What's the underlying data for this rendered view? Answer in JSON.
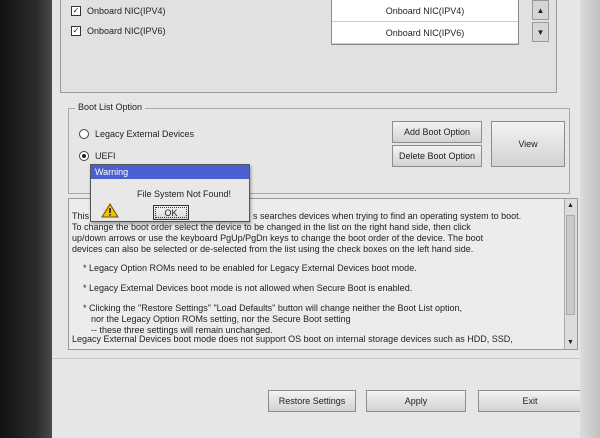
{
  "boot_sequence": {
    "items": [
      {
        "label": "Onboard NIC(IPV4)",
        "checked": true
      },
      {
        "label": "Onboard NIC(IPV6)",
        "checked": true
      }
    ],
    "order_list": [
      "Onboard NIC(IPV4)",
      "Onboard NIC(IPV6)"
    ],
    "up_arrow": "▲",
    "down_arrow": "▼",
    "check_mark": "✓"
  },
  "boot_list_option": {
    "legend": "Boot List Option",
    "options": [
      {
        "label": "Legacy External Devices",
        "selected": false
      },
      {
        "label": "UEFI",
        "selected": true
      }
    ],
    "add_boot_option": "Add Boot Option",
    "delete_boot_option": "Delete Boot Option",
    "view": "View"
  },
  "warning_dialog": {
    "title": "Warning",
    "message": "File System Not Found!",
    "ok": "OK"
  },
  "help_text": {
    "line1_prefix": "This",
    "line1_rest": "s searches devices when trying to find an operating system to boot.",
    "line2": "To change the boot order select the device to be changed in the list on the right hand side, then click",
    "line3": "up/down arrows or use the keyboard PgUp/PgDn keys to change the boot order of the device. The boot",
    "line4": "devices can also be selected or de-selected from the list using the check boxes on the left hand side.",
    "bullet1": "* Legacy Option ROMs need to be enabled for Legacy External Devices boot mode.",
    "bullet2": "* Legacy External Devices boot mode is not allowed when Secure Boot is enabled.",
    "bullet3a": "* Clicking the \"Restore Settings\" \"Load Defaults\" button will change neither the Boot List option,",
    "bullet3b": "nor the Legacy Option ROMs setting, nor the Secure Boot setting",
    "bullet3c": "-- these three settings will remain unchanged.",
    "last_line": "Legacy External Devices boot mode does not support OS boot on internal storage devices such as HDD, SSD,"
  },
  "footer": {
    "restore_settings": "Restore Settings",
    "apply": "Apply",
    "exit": "Exit"
  },
  "colors": {
    "dialog_title_bg": "#4a5fd0",
    "warning_icon": "#f2c200"
  }
}
